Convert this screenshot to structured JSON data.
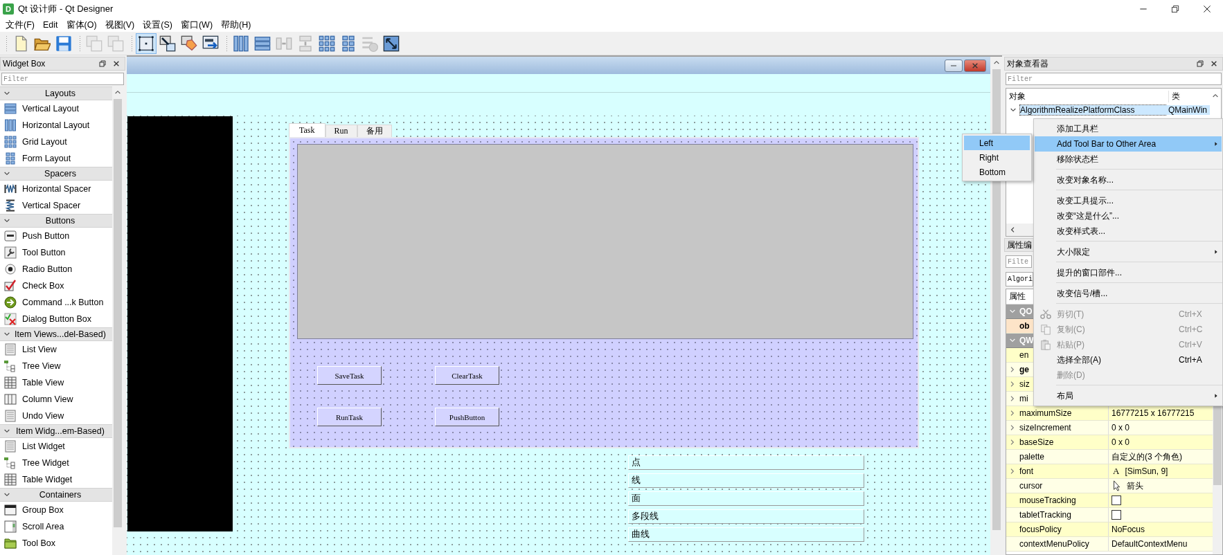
{
  "window": {
    "icon": "D",
    "title": "Qt 设计师 - Qt Designer"
  },
  "menu_bar": [
    "文件(F)",
    "Edit",
    "窗体(O)",
    "视图(V)",
    "设置(S)",
    "窗口(W)",
    "帮助(H)"
  ],
  "toolbar": [
    [
      {
        "disabled": false,
        "selected": false
      },
      {
        "disabled": false,
        "selected": false
      },
      {
        "disabled": false,
        "selected": false
      }
    ],
    [
      {
        "disabled": true,
        "selected": false
      },
      {
        "disabled": true,
        "selected": false
      }
    ],
    [
      {
        "disabled": false,
        "selected": true
      },
      {
        "disabled": false,
        "selected": false
      },
      {
        "disabled": false,
        "selected": false
      },
      {
        "disabled": false,
        "selected": false
      }
    ],
    [
      {
        "disabled": false,
        "selected": false
      },
      {
        "disabled": false,
        "selected": false
      },
      {
        "disabled": true,
        "selected": false
      },
      {
        "disabled": true,
        "selected": false
      },
      {
        "disabled": false,
        "selected": false
      },
      {
        "disabled": false,
        "selected": false
      },
      {
        "disabled": true,
        "selected": false
      },
      {
        "disabled": false,
        "selected": false
      }
    ]
  ],
  "widget_box": {
    "title": "Widget Box",
    "filter": {
      "placeholder": "Filter"
    },
    "categories": [
      {
        "title": "Layouts",
        "expanded": true,
        "items": [
          "Vertical Layout",
          "Horizontal Layout",
          "Grid Layout",
          "Form Layout"
        ]
      },
      {
        "title": "Spacers",
        "expanded": true,
        "items": [
          "Horizontal Spacer",
          "Vertical Spacer"
        ]
      },
      {
        "title": "Buttons",
        "expanded": true,
        "items": [
          "Push Button",
          "Tool Button",
          "Radio Button",
          "Check Box",
          "Command ...k Button",
          "Dialog Button Box"
        ]
      },
      {
        "title": "Item Views...del-Based)",
        "expanded": true,
        "items": [
          "List View",
          "Tree View",
          "Table View",
          "Column View",
          "Undo View"
        ]
      },
      {
        "title": "Item Widg...em-Based)",
        "expanded": true,
        "items": [
          "List Widget",
          "Tree Widget",
          "Table Widget"
        ]
      },
      {
        "title": "Containers",
        "expanded": true,
        "items": [
          "Group Box",
          "Scroll Area",
          "Tool Box"
        ]
      }
    ]
  },
  "form": {
    "tabs": [
      {
        "label": "Task",
        "selected": true
      },
      {
        "label": "Run",
        "selected": false
      },
      {
        "label": "备用",
        "selected": false
      }
    ],
    "buttons": [
      "SaveTask",
      "ClearTask",
      "RunTask",
      "PushButton"
    ],
    "line_edits": [
      "点",
      "线",
      "面",
      "多段线",
      "曲线"
    ]
  },
  "object_inspector": {
    "title": "对象查看器",
    "filter": {
      "placeholder": "Filter"
    },
    "columns": [
      "对象",
      "类"
    ],
    "rows": [
      {
        "object": "AlgorithmRealizePlatformClass",
        "class": "QMainWin",
        "expanded": true,
        "selected": true
      }
    ]
  },
  "property_editor": {
    "title": "属性编",
    "filter": {
      "placeholder": "Filte"
    },
    "object": "Algori",
    "columns": [
      "属性"
    ],
    "groups": [
      {
        "name": "QO",
        "expanded": true,
        "color": "#fde4c8",
        "rows": [
          {
            "kind": "text",
            "name": "ob",
            "modified": true,
            "expandable": false
          }
        ]
      },
      {
        "name": "QW",
        "expanded": true,
        "color": "#ffffc8",
        "rows": [
          {
            "kind": "text",
            "name": "en",
            "modified": false,
            "expandable": false
          },
          {
            "kind": "text",
            "name": "ge",
            "modified": true,
            "expandable": true
          },
          {
            "kind": "text",
            "name": "siz",
            "modified": false,
            "expandable": true
          },
          {
            "kind": "text",
            "name": "mi",
            "modified": false,
            "expandable": true
          },
          {
            "kind": "text",
            "name": "maximumSize",
            "value": "16777215 x 16777215",
            "modified": false,
            "expandable": true
          },
          {
            "kind": "text",
            "name": "sizeIncrement",
            "value": "0 x 0",
            "modified": false,
            "expandable": true
          },
          {
            "kind": "text",
            "name": "baseSize",
            "value": "0 x 0",
            "modified": false,
            "expandable": true
          },
          {
            "kind": "text",
            "name": "palette",
            "value": "自定义的(3 个角色)",
            "modified": false,
            "expandable": false
          },
          {
            "kind": "font",
            "name": "font",
            "sample": "A",
            "value": "[SimSun, 9]",
            "modified": false,
            "expandable": true
          },
          {
            "kind": "cursor",
            "name": "cursor",
            "value": "箭头",
            "modified": false,
            "expandable": false
          },
          {
            "kind": "checkbox",
            "name": "mouseTracking",
            "checked": false,
            "modified": false,
            "expandable": false
          },
          {
            "kind": "checkbox",
            "name": "tabletTracking",
            "checked": false,
            "modified": false,
            "expandable": false
          },
          {
            "kind": "text",
            "name": "focusPolicy",
            "value": "NoFocus",
            "modified": false,
            "expandable": false
          },
          {
            "kind": "text",
            "name": "contextMenuPolicy",
            "value": "DefaultContextMenu",
            "modified": false,
            "expandable": false
          }
        ]
      }
    ]
  },
  "context_menu": {
    "items": [
      {
        "kind": "item",
        "label": "添加工具栏",
        "selected": false,
        "disabled": false,
        "submenu": false
      },
      {
        "kind": "item",
        "label": "Add Tool Bar to Other Area",
        "selected": true,
        "disabled": false,
        "submenu": true
      },
      {
        "kind": "item",
        "label": "移除状态栏",
        "selected": false,
        "disabled": false,
        "submenu": false
      },
      {
        "kind": "separator"
      },
      {
        "kind": "item",
        "label": "改变对象名称...",
        "selected": false,
        "disabled": false,
        "submenu": false
      },
      {
        "kind": "separator"
      },
      {
        "kind": "item",
        "label": "改变工具提示...",
        "selected": false,
        "disabled": false,
        "submenu": false
      },
      {
        "kind": "item",
        "label": "改变“这是什么”...",
        "selected": false,
        "disabled": false,
        "submenu": false
      },
      {
        "kind": "item",
        "label": "改变样式表...",
        "selected": false,
        "disabled": false,
        "submenu": false
      },
      {
        "kind": "separator"
      },
      {
        "kind": "item",
        "label": "大小限定",
        "selected": false,
        "disabled": false,
        "submenu": true
      },
      {
        "kind": "separator"
      },
      {
        "kind": "item",
        "label": "提升的窗口部件...",
        "selected": false,
        "disabled": false,
        "submenu": false
      },
      {
        "kind": "separator"
      },
      {
        "kind": "item",
        "label": "改变信号/槽...",
        "selected": false,
        "disabled": false,
        "submenu": false
      },
      {
        "kind": "separator"
      },
      {
        "kind": "item",
        "label": "剪切(T)",
        "shortcut": "Ctrl+X",
        "selected": false,
        "disabled": true,
        "submenu": false
      },
      {
        "kind": "item",
        "label": "复制(C)",
        "shortcut": "Ctrl+C",
        "selected": false,
        "disabled": true,
        "submenu": false
      },
      {
        "kind": "item",
        "label": "粘贴(P)",
        "shortcut": "Ctrl+V",
        "selected": false,
        "disabled": true,
        "submenu": false
      },
      {
        "kind": "item",
        "label": "选择全部(A)",
        "shortcut": "Ctrl+A",
        "selected": false,
        "disabled": false,
        "submenu": false
      },
      {
        "kind": "item",
        "label": "删除(D)",
        "selected": false,
        "disabled": true,
        "submenu": false
      },
      {
        "kind": "separator"
      },
      {
        "kind": "item",
        "label": "布局",
        "selected": false,
        "disabled": false,
        "submenu": true
      }
    ]
  },
  "submenu": {
    "items": [
      {
        "label": "Left",
        "selected": true
      },
      {
        "label": "Right",
        "selected": false
      },
      {
        "label": "Bottom",
        "selected": false
      }
    ]
  }
}
